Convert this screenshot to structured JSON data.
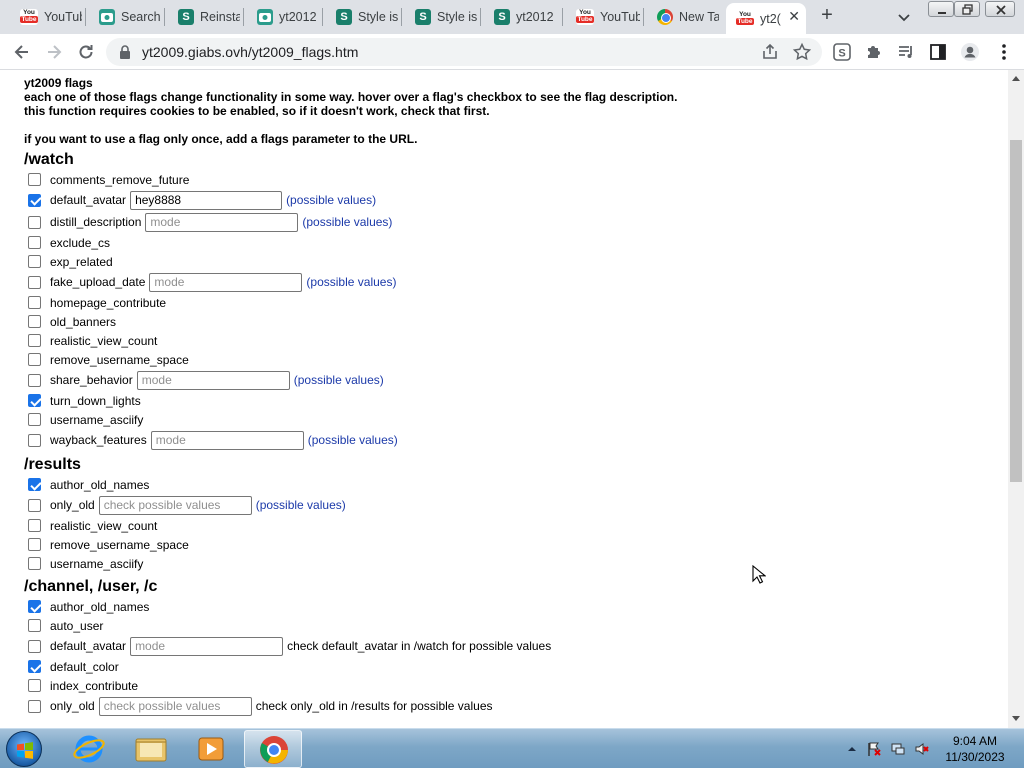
{
  "browser": {
    "tabs": [
      {
        "label": "YouTub",
        "icon": "youtube-favicon"
      },
      {
        "label": "Search",
        "icon": "camera-favicon"
      },
      {
        "label": "Reinsta",
        "icon": "s-favicon"
      },
      {
        "label": "yt2012",
        "icon": "camera-favicon"
      },
      {
        "label": "Style is",
        "icon": "s-favicon"
      },
      {
        "label": "Style is",
        "icon": "s-favicon"
      },
      {
        "label": "yt2012",
        "icon": "s-favicon"
      },
      {
        "label": "YouTub",
        "icon": "youtube-favicon"
      },
      {
        "label": "New Ta",
        "icon": "chrome-favicon"
      },
      {
        "label": "yt2(",
        "icon": "youtube-favicon",
        "active": true
      }
    ],
    "url": "yt2009.giabs.ovh/yt2009_flags.htm",
    "favicon_you": "You",
    "favicon_tube": "Tube",
    "favicon_s": "S"
  },
  "page": {
    "title": "yt2009 flags",
    "intro": [
      "each one of those flags change functionality in some way. hover over a flag's checkbox to see the flag description.",
      "this function requires cookies to be enabled, so if it doesn't work, check that first."
    ],
    "note": "if you want to use a flag only once, add a flags parameter to the URL.",
    "possible_values_link": "(possible values)",
    "sections": [
      {
        "heading": "/watch",
        "flags": [
          {
            "name": "comments_remove_future",
            "checked": false
          },
          {
            "name": "default_avatar",
            "checked": true,
            "input_value": "hey8888",
            "input_placeholder": "",
            "input_width": 152,
            "link": true
          },
          {
            "name": "distill_description",
            "checked": false,
            "input_value": "",
            "input_placeholder": "mode",
            "input_width": 153,
            "link": true
          },
          {
            "name": "exclude_cs",
            "checked": false
          },
          {
            "name": "exp_related",
            "checked": false
          },
          {
            "name": "fake_upload_date",
            "checked": false,
            "input_value": "",
            "input_placeholder": "mode",
            "input_width": 153,
            "link": true
          },
          {
            "name": "homepage_contribute",
            "checked": false
          },
          {
            "name": "old_banners",
            "checked": false
          },
          {
            "name": "realistic_view_count",
            "checked": false
          },
          {
            "name": "remove_username_space",
            "checked": false
          },
          {
            "name": "share_behavior",
            "checked": false,
            "input_value": "",
            "input_placeholder": "mode",
            "input_width": 153,
            "link": true
          },
          {
            "name": "turn_down_lights",
            "checked": true
          },
          {
            "name": "username_asciify",
            "checked": false
          },
          {
            "name": "wayback_features",
            "checked": false,
            "input_value": "",
            "input_placeholder": "mode",
            "input_width": 153,
            "link": true
          }
        ]
      },
      {
        "heading": "/results",
        "flags": [
          {
            "name": "author_old_names",
            "checked": true
          },
          {
            "name": "only_old",
            "checked": false,
            "input_value": "",
            "input_placeholder": "check possible values",
            "input_width": 153,
            "link": true
          },
          {
            "name": "realistic_view_count",
            "checked": false
          },
          {
            "name": "remove_username_space",
            "checked": false
          },
          {
            "name": "username_asciify",
            "checked": false
          }
        ]
      },
      {
        "heading": "/channel, /user, /c",
        "flags": [
          {
            "name": "author_old_names",
            "checked": true
          },
          {
            "name": "auto_user",
            "checked": false
          },
          {
            "name": "default_avatar",
            "checked": false,
            "input_value": "",
            "input_placeholder": "mode",
            "input_width": 153,
            "hint": "check default_avatar in /watch for possible values"
          },
          {
            "name": "default_color",
            "checked": true
          },
          {
            "name": "index_contribute",
            "checked": false
          },
          {
            "name": "only_old",
            "checked": false,
            "input_value": "",
            "input_placeholder": "check possible values",
            "input_width": 153,
            "hint": "check only_old in /results for possible values"
          }
        ]
      }
    ]
  },
  "taskbar": {
    "apps": [
      "windows-explorer",
      "internet-explorer",
      "file-explorer",
      "media-player",
      "google-chrome"
    ],
    "clock_time": "9:04 AM",
    "clock_date": "11/30/2023"
  }
}
